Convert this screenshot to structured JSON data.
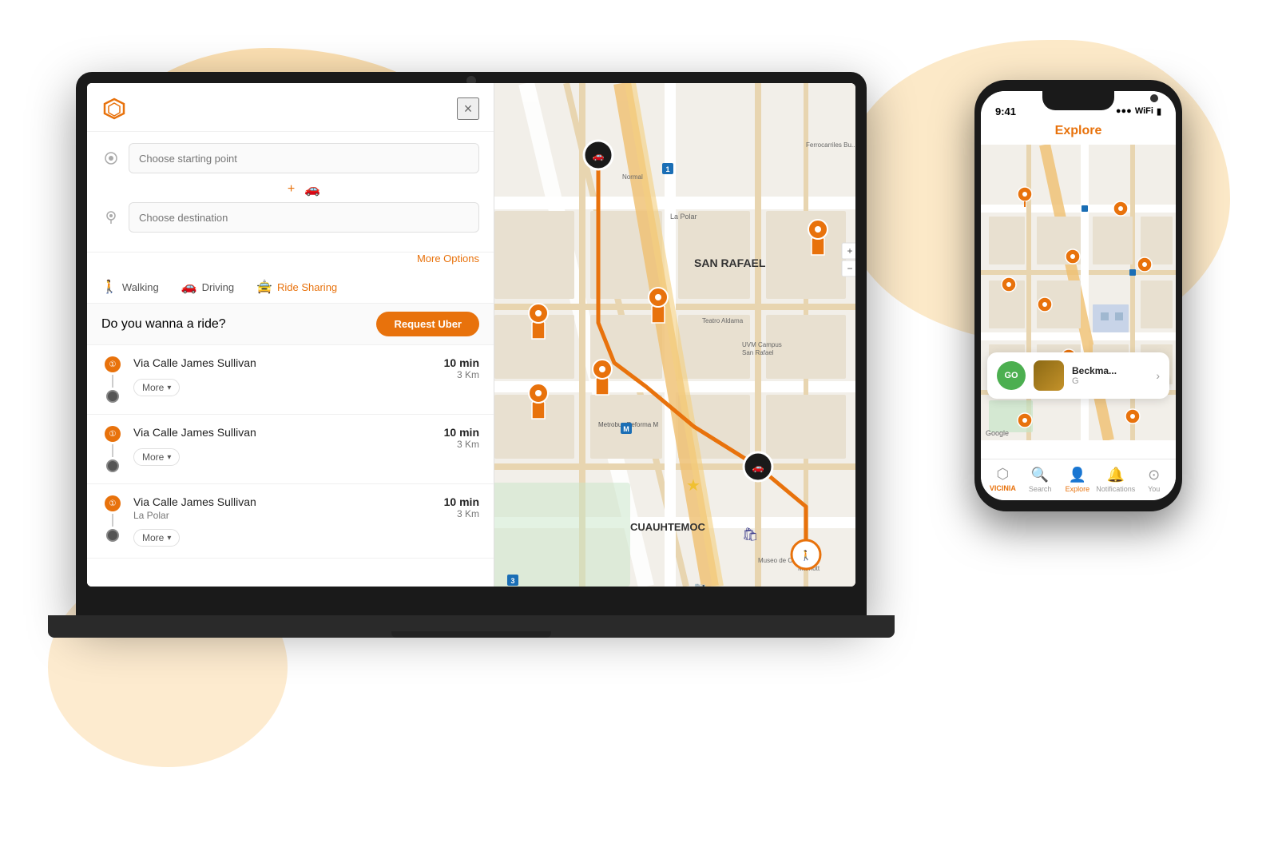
{
  "background": {
    "blob_colors": [
      "#f5a623",
      "#f5a623"
    ]
  },
  "laptop": {
    "sidebar": {
      "brand_icon": "◈",
      "close_label": "×",
      "starting_point_placeholder": "Choose starting point",
      "destination_placeholder": "Choose destination",
      "more_options_label": "More Options",
      "transport_modes": [
        {
          "id": "walking",
          "label": "Walking",
          "icon": "🚶",
          "active": false
        },
        {
          "id": "driving",
          "label": "Driving",
          "icon": "🚗",
          "active": false
        },
        {
          "id": "rideshare",
          "label": "Ride Sharing",
          "icon": "🚖",
          "active": true
        }
      ],
      "uber_question": "Do you wanna a ride?",
      "uber_button_label": "Request Uber",
      "route_options": [
        {
          "name": "Via Calle James Sullivan",
          "time": "10 min",
          "distance": "3 Km",
          "more_label": "More"
        },
        {
          "name": "Via Calle James Sullivan",
          "time": "10 min",
          "distance": "3 Km",
          "more_label": "More"
        },
        {
          "name": "Via Calle James Sullivan",
          "time": "10 min",
          "distance": "3 Km",
          "sub": "La Polar",
          "more_label": "More"
        }
      ]
    },
    "map": {
      "neighborhood": "SAN RAFAEL",
      "district": "CUAUHTEMOC",
      "landmarks": [
        "La Polar",
        "UVM Campus San Rafael",
        "Teatro Aldama",
        "Metrobus Reforma",
        "Museo de Cera",
        "Marriott",
        "Ferrocarriles Bu...",
        "Normal"
      ],
      "route_color": "#e8720c"
    }
  },
  "phone": {
    "status_bar": {
      "time": "9:41",
      "signal": "●●●",
      "wifi": "WiFi",
      "battery": "■"
    },
    "header_title": "Explore",
    "bottom_card": {
      "go_label": "GO",
      "place_name": "Beckma...",
      "place_sub": "G",
      "arrow": "›"
    },
    "tab_bar": [
      {
        "id": "vicinia",
        "label": "VICINIA",
        "icon": "⬡",
        "active": false
      },
      {
        "id": "search",
        "label": "Search",
        "icon": "🔍",
        "active": false
      },
      {
        "id": "explore",
        "label": "Explore",
        "icon": "👤",
        "active": true
      },
      {
        "id": "notifications",
        "label": "Notifications",
        "icon": "🔔",
        "active": false
      },
      {
        "id": "you",
        "label": "You",
        "icon": "👤",
        "active": false
      }
    ]
  }
}
